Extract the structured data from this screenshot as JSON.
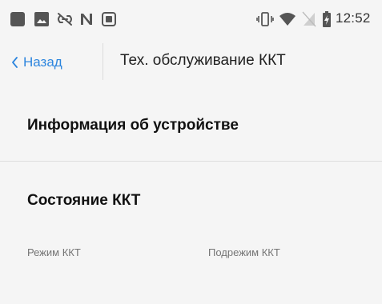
{
  "status_bar": {
    "time": "12:52",
    "icons": [
      "notification-square-icon",
      "image-icon",
      "link-off-icon",
      "nfc-icon",
      "screen-record-icon",
      "vibrate-icon",
      "wifi-icon",
      "no-sim-icon",
      "battery-charging-icon"
    ]
  },
  "nav": {
    "back_label": "Назад",
    "title": "Тех. обслуживание ККТ"
  },
  "sections": {
    "device_info": "Информация об устройстве",
    "kkt_state": "Состояние ККТ"
  },
  "fields": {
    "mode_label": "Режим ККТ",
    "submode_label": "Подрежим ККТ"
  },
  "colors": {
    "accent": "#2e86de",
    "background": "#f5f5f5"
  }
}
